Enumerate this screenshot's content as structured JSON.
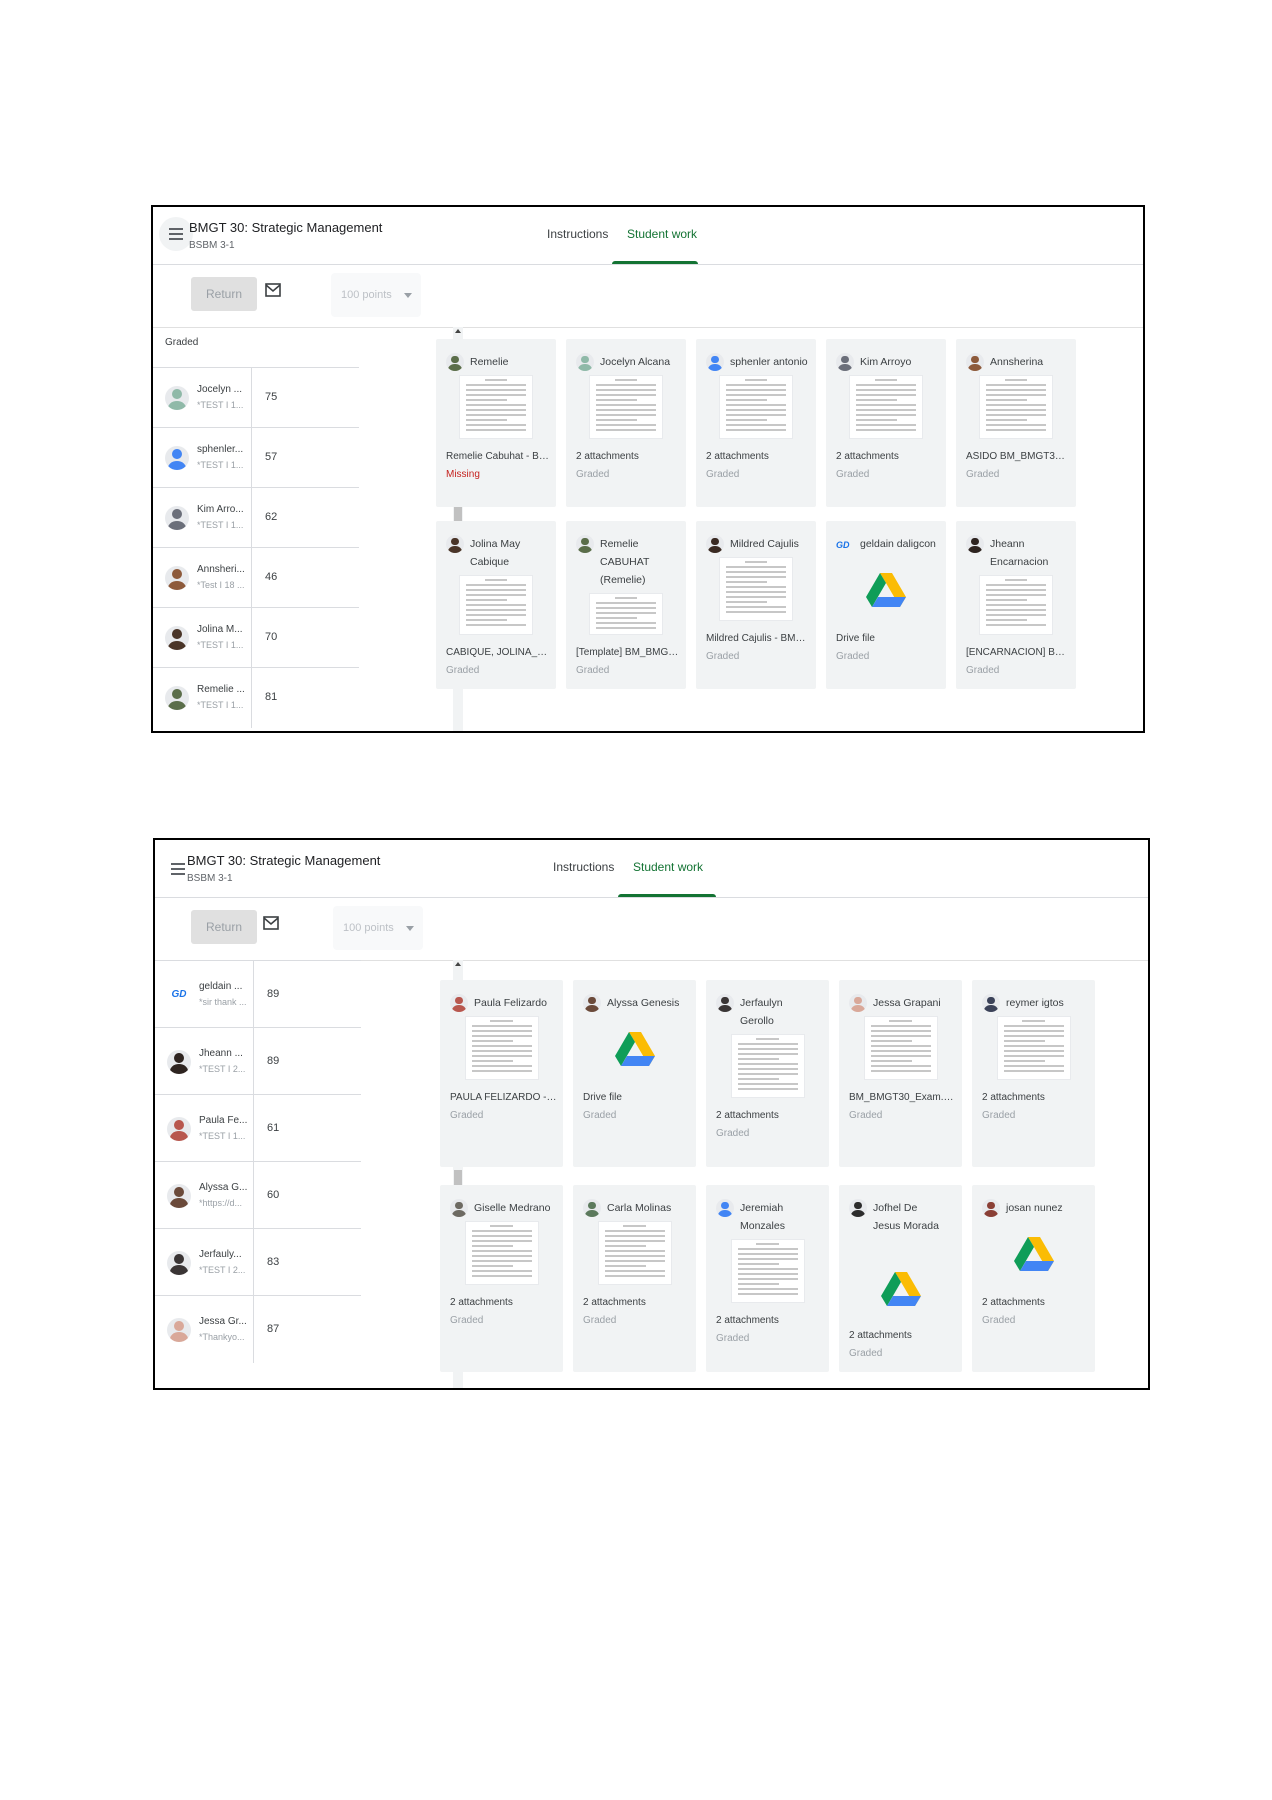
{
  "screenshots": [
    {
      "course_title": "BMGT 30: Strategic Management",
      "course_section": "BSBM 3-1",
      "tabs": [
        "Instructions",
        "Student work"
      ],
      "active_tab": "Student work",
      "return_label": "Return",
      "points_label": "100 points",
      "graded_label": "Graded",
      "students": [
        {
          "name": "Jocelyn ...",
          "note": "*TEST I 1...",
          "grade": "75",
          "avatar_color": "#8fb9a8"
        },
        {
          "name": "sphenler...",
          "note": "*TEST I 1...",
          "grade": "57",
          "avatar_color": "#4285f4"
        },
        {
          "name": "Kim Arro...",
          "note": "*TEST I 1...",
          "grade": "62",
          "avatar_color": "#6b6f7a"
        },
        {
          "name": "Annsheri...",
          "note": "*Test I 18 ...",
          "grade": "46",
          "avatar_color": "#8d5a3b"
        },
        {
          "name": "Jolina M...",
          "note": "*TEST I 1...",
          "grade": "70",
          "avatar_color": "#4a3528"
        },
        {
          "name": "Remelie ...",
          "note": "*TEST I 1...",
          "grade": "81",
          "avatar_color": "#5b6e4a"
        }
      ],
      "cards": [
        {
          "name": "Remelie Cabuhat",
          "file": "Remelie Cabuhat - BM...",
          "status": "Missing",
          "kind": "doc",
          "avatar_color": "#5b6e4a"
        },
        {
          "name": "Jocelyn Alcana",
          "file": "2 attachments",
          "status": "Graded",
          "kind": "doc",
          "avatar_color": "#8fb9a8"
        },
        {
          "name": "sphenler antonio",
          "file": "2 attachments",
          "status": "Graded",
          "kind": "doc",
          "avatar_color": "#4285f4"
        },
        {
          "name": "Kim Arroyo",
          "file": "2 attachments",
          "status": "Graded",
          "kind": "doc",
          "avatar_color": "#6b6f7a"
        },
        {
          "name": "Annsherina Asido",
          "file": "ASIDO BM_BMGT30_...",
          "status": "Graded",
          "kind": "doc",
          "avatar_color": "#8d5a3b"
        },
        {
          "name": "Jolina May Cabique",
          "file": "CABIQUE, JOLINA_ST...",
          "status": "Graded",
          "kind": "doc",
          "avatar_color": "#4a3528"
        },
        {
          "name": "Remelie CABUHAT (Remelie)",
          "file": "[Template] BM_BMGT...",
          "status": "Graded",
          "kind": "doc",
          "avatar_color": "#5b6e4a"
        },
        {
          "name": "Mildred Cajulis",
          "file": "Mildred Cajulis - BM_B...",
          "status": "Graded",
          "kind": "doc",
          "avatar_color": "#3a2a22"
        },
        {
          "name": "geldain daligcon",
          "file": "Drive file",
          "status": "Graded",
          "kind": "drive",
          "avatar_color": "#ffffff",
          "avatar_text": "GD"
        },
        {
          "name": "Jheann Encarnacion",
          "file": "[ENCARNACION] BM_...",
          "status": "Graded",
          "kind": "doc",
          "avatar_color": "#2e2420"
        }
      ]
    },
    {
      "course_title": "BMGT 30: Strategic Management",
      "course_section": "BSBM 3-1",
      "tabs": [
        "Instructions",
        "Student work"
      ],
      "active_tab": "Student work",
      "return_label": "Return",
      "points_label": "100 points",
      "students": [
        {
          "name": "geldain ...",
          "note": "*sir thank ...",
          "grade": "89",
          "avatar_color": "#ffffff",
          "avatar_text": "GD"
        },
        {
          "name": "Jheann ...",
          "note": "*TEST I 2...",
          "grade": "89",
          "avatar_color": "#2e2420"
        },
        {
          "name": "Paula Fe...",
          "note": "*TEST I 1...",
          "grade": "61",
          "avatar_color": "#b8574e"
        },
        {
          "name": "Alyssa G...",
          "note": "*https://d...",
          "grade": "60",
          "avatar_color": "#6b4a3a"
        },
        {
          "name": "Jerfauly...",
          "note": "*TEST I 2...",
          "grade": "83",
          "avatar_color": "#3a3535"
        },
        {
          "name": "Jessa Gr...",
          "note": "*Thankyo...",
          "grade": "87",
          "avatar_color": "#d9a899"
        }
      ],
      "cards": [
        {
          "name": "Paula Felizardo",
          "file": "PAULA FELIZARDO - B...",
          "status": "Graded",
          "kind": "doc",
          "avatar_color": "#b8574e"
        },
        {
          "name": "Alyssa Genesis",
          "file": "Drive file",
          "status": "Graded",
          "kind": "drive",
          "avatar_color": "#6b4a3a"
        },
        {
          "name": "Jerfaulyn Gerollo",
          "file": "2 attachments",
          "status": "Graded",
          "kind": "doc",
          "avatar_color": "#3a3535"
        },
        {
          "name": "Jessa Grapani",
          "file": "BM_BMGT30_Exam.d...",
          "status": "Graded",
          "kind": "doc",
          "avatar_color": "#d9a899"
        },
        {
          "name": "reymer igtos",
          "file": "2 attachments",
          "status": "Graded",
          "kind": "doc",
          "avatar_color": "#3b4258"
        },
        {
          "name": "Giselle Medrano",
          "file": "2 attachments",
          "status": "Graded",
          "kind": "doc",
          "avatar_color": "#6d6a62"
        },
        {
          "name": "Carla Molinas",
          "file": "2 attachments",
          "status": "Graded",
          "kind": "doc",
          "avatar_color": "#5c7a5c"
        },
        {
          "name": "Jeremiah Monzales",
          "file": "2 attachments",
          "status": "Graded",
          "kind": "doc",
          "avatar_color": "#4285f4"
        },
        {
          "name": "Jofhel De Jesus Morada",
          "file": "2 attachments",
          "status": "Graded",
          "kind": "drive",
          "avatar_color": "#2c2c2c"
        },
        {
          "name": "josan nunez",
          "file": "2 attachments",
          "status": "Graded",
          "kind": "drive",
          "avatar_color": "#8a3f35"
        }
      ]
    }
  ],
  "icons": {
    "menu": "hamburger-icon",
    "mail": "envelope-icon",
    "dropdown": "caret-down-icon",
    "drive": "google-drive-icon"
  },
  "colors": {
    "accent_green": "#137333",
    "missing_red": "#c5221f",
    "card_bg": "#f1f3f4",
    "return_bg": "#e0e0e0"
  }
}
